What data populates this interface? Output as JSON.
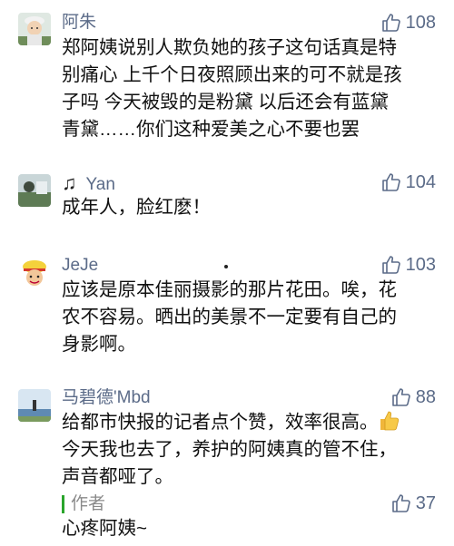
{
  "comments": [
    {
      "name": "阿朱",
      "likes": "108",
      "lines": [
        "郑阿姨说别人欺负她的孩子这句话真是特",
        "别痛心 上千个日夜照顾出来的可不就是孩",
        "子吗 今天被毁的是粉黛 以后还会有蓝黛",
        "青黛……你们这种爱美之心不要也罢"
      ]
    },
    {
      "name": "Yan",
      "name_prefix": "♫",
      "likes": "104",
      "lines": [
        "成年人，脸红麽！"
      ]
    },
    {
      "name": "JeJe",
      "likes": "103",
      "lines": [
        "应该是原本佳丽摄影的那片花田。唉，花",
        "农不容易。晒出的美景不一定要有自己的",
        "身影啊。"
      ]
    },
    {
      "name": "马碧德'Mbd",
      "likes": "88",
      "lines": [
        "给都市快报的记者点个赞，效率很高。",
        "今天我也去了，养护的阿姨真的管不住，",
        "声音都哑了。"
      ],
      "reply": {
        "author": "作者",
        "likes": "37",
        "text": "心疼阿姨~"
      }
    }
  ],
  "colors": {
    "name": "#5b6b88",
    "text": "#111111",
    "author_bar": "#2aa52c"
  }
}
